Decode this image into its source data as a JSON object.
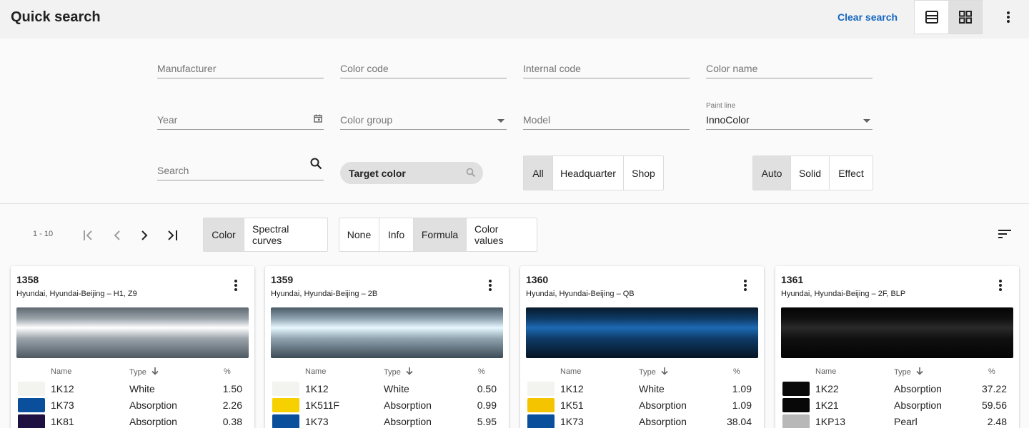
{
  "header": {
    "title": "Quick search",
    "clear_search": "Clear search"
  },
  "filters": {
    "manufacturer": "Manufacturer",
    "color_code": "Color code",
    "internal_code": "Internal code",
    "color_name": "Color name",
    "year": "Year",
    "color_group": "Color group",
    "model": "Model",
    "paint_line_label": "Paint line",
    "paint_line_value": "InnoColor",
    "search": "Search",
    "target_color": "Target color",
    "scope_options": [
      "All",
      "Headquarter",
      "Shop"
    ],
    "scope_selected": "All",
    "finish_options": [
      "Auto",
      "Solid",
      "Effect"
    ],
    "finish_selected": "Auto"
  },
  "toolbar": {
    "range": "1 - 10",
    "view_options": [
      "Color",
      "Spectral curves"
    ],
    "view_selected": "Color",
    "detail_options": [
      "None",
      "Info",
      "Formula",
      "Color values"
    ],
    "detail_selected": "Formula"
  },
  "table_headers": {
    "name": "Name",
    "type": "Type",
    "pct": "%"
  },
  "cards": [
    {
      "id": "1358",
      "desc": "Hyundai, Hyundai-Beijing – H1, Z9",
      "swatch": [
        "#5e6870",
        "#9aa3aa",
        "#ffffff",
        "#9aa3aa",
        "#4d5861"
      ],
      "rows": [
        {
          "name": "1K12",
          "type": "White",
          "pct": "1.50",
          "color": "#f3f4ef"
        },
        {
          "name": "1K73",
          "type": "Absorption",
          "pct": "2.26",
          "color": "#0a4f9c"
        },
        {
          "name": "1K81",
          "type": "Absorption",
          "pct": "0.38",
          "color": "#1e1040"
        }
      ]
    },
    {
      "id": "1359",
      "desc": "Hyundai, Hyundai-Beijing – 2B",
      "swatch": [
        "#4a5a66",
        "#8fa3b0",
        "#e8f8ff",
        "#8ea2ae",
        "#3c4a55"
      ],
      "rows": [
        {
          "name": "1K12",
          "type": "White",
          "pct": "0.50",
          "color": "#f3f4ef"
        },
        {
          "name": "1K511F",
          "type": "Absorption",
          "pct": "0.99",
          "color": "#f7d000"
        },
        {
          "name": "1K73",
          "type": "Absorption",
          "pct": "5.95",
          "color": "#0a4f9c"
        }
      ]
    },
    {
      "id": "1360",
      "desc": "Hyundai, Hyundai-Beijing – QB",
      "swatch": [
        "#081a2c",
        "#0e3a66",
        "#1d6ab3",
        "#0e3a66",
        "#061422"
      ],
      "rows": [
        {
          "name": "1K12",
          "type": "White",
          "pct": "1.09",
          "color": "#f3f4ef"
        },
        {
          "name": "1K51",
          "type": "Absorption",
          "pct": "1.09",
          "color": "#f5c400"
        },
        {
          "name": "1K73",
          "type": "Absorption",
          "pct": "38.04",
          "color": "#0a4f9c"
        }
      ]
    },
    {
      "id": "1361",
      "desc": "Hyundai, Hyundai-Beijing – 2F, BLP",
      "swatch": [
        "#050505",
        "#101010",
        "#2a2a2a",
        "#101010",
        "#040404"
      ],
      "rows": [
        {
          "name": "1K22",
          "type": "Absorption",
          "pct": "37.22",
          "color": "#0a0a0a"
        },
        {
          "name": "1K21",
          "type": "Absorption",
          "pct": "59.56",
          "color": "#080808"
        },
        {
          "name": "1KP13",
          "type": "Pearl",
          "pct": "2.48",
          "color": "#b8b8b8"
        }
      ]
    }
  ]
}
